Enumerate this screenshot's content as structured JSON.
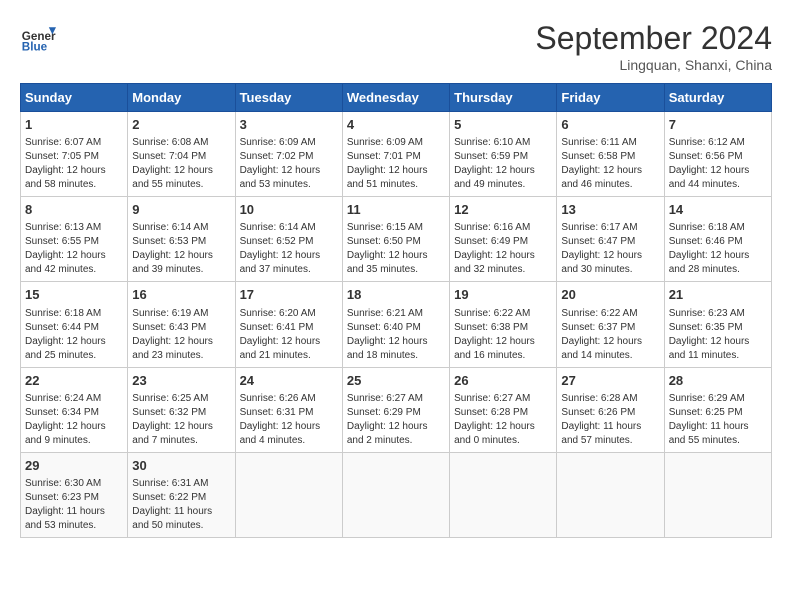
{
  "logo": {
    "line1": "General",
    "line2": "Blue"
  },
  "title": "September 2024",
  "subtitle": "Lingquan, Shanxi, China",
  "days_header": [
    "Sunday",
    "Monday",
    "Tuesday",
    "Wednesday",
    "Thursday",
    "Friday",
    "Saturday"
  ],
  "weeks": [
    [
      {
        "day": "1",
        "lines": [
          "Sunrise: 6:07 AM",
          "Sunset: 7:05 PM",
          "Daylight: 12 hours",
          "and 58 minutes."
        ]
      },
      {
        "day": "2",
        "lines": [
          "Sunrise: 6:08 AM",
          "Sunset: 7:04 PM",
          "Daylight: 12 hours",
          "and 55 minutes."
        ]
      },
      {
        "day": "3",
        "lines": [
          "Sunrise: 6:09 AM",
          "Sunset: 7:02 PM",
          "Daylight: 12 hours",
          "and 53 minutes."
        ]
      },
      {
        "day": "4",
        "lines": [
          "Sunrise: 6:09 AM",
          "Sunset: 7:01 PM",
          "Daylight: 12 hours",
          "and 51 minutes."
        ]
      },
      {
        "day": "5",
        "lines": [
          "Sunrise: 6:10 AM",
          "Sunset: 6:59 PM",
          "Daylight: 12 hours",
          "and 49 minutes."
        ]
      },
      {
        "day": "6",
        "lines": [
          "Sunrise: 6:11 AM",
          "Sunset: 6:58 PM",
          "Daylight: 12 hours",
          "and 46 minutes."
        ]
      },
      {
        "day": "7",
        "lines": [
          "Sunrise: 6:12 AM",
          "Sunset: 6:56 PM",
          "Daylight: 12 hours",
          "and 44 minutes."
        ]
      }
    ],
    [
      {
        "day": "8",
        "lines": [
          "Sunrise: 6:13 AM",
          "Sunset: 6:55 PM",
          "Daylight: 12 hours",
          "and 42 minutes."
        ]
      },
      {
        "day": "9",
        "lines": [
          "Sunrise: 6:14 AM",
          "Sunset: 6:53 PM",
          "Daylight: 12 hours",
          "and 39 minutes."
        ]
      },
      {
        "day": "10",
        "lines": [
          "Sunrise: 6:14 AM",
          "Sunset: 6:52 PM",
          "Daylight: 12 hours",
          "and 37 minutes."
        ]
      },
      {
        "day": "11",
        "lines": [
          "Sunrise: 6:15 AM",
          "Sunset: 6:50 PM",
          "Daylight: 12 hours",
          "and 35 minutes."
        ]
      },
      {
        "day": "12",
        "lines": [
          "Sunrise: 6:16 AM",
          "Sunset: 6:49 PM",
          "Daylight: 12 hours",
          "and 32 minutes."
        ]
      },
      {
        "day": "13",
        "lines": [
          "Sunrise: 6:17 AM",
          "Sunset: 6:47 PM",
          "Daylight: 12 hours",
          "and 30 minutes."
        ]
      },
      {
        "day": "14",
        "lines": [
          "Sunrise: 6:18 AM",
          "Sunset: 6:46 PM",
          "Daylight: 12 hours",
          "and 28 minutes."
        ]
      }
    ],
    [
      {
        "day": "15",
        "lines": [
          "Sunrise: 6:18 AM",
          "Sunset: 6:44 PM",
          "Daylight: 12 hours",
          "and 25 minutes."
        ]
      },
      {
        "day": "16",
        "lines": [
          "Sunrise: 6:19 AM",
          "Sunset: 6:43 PM",
          "Daylight: 12 hours",
          "and 23 minutes."
        ]
      },
      {
        "day": "17",
        "lines": [
          "Sunrise: 6:20 AM",
          "Sunset: 6:41 PM",
          "Daylight: 12 hours",
          "and 21 minutes."
        ]
      },
      {
        "day": "18",
        "lines": [
          "Sunrise: 6:21 AM",
          "Sunset: 6:40 PM",
          "Daylight: 12 hours",
          "and 18 minutes."
        ]
      },
      {
        "day": "19",
        "lines": [
          "Sunrise: 6:22 AM",
          "Sunset: 6:38 PM",
          "Daylight: 12 hours",
          "and 16 minutes."
        ]
      },
      {
        "day": "20",
        "lines": [
          "Sunrise: 6:22 AM",
          "Sunset: 6:37 PM",
          "Daylight: 12 hours",
          "and 14 minutes."
        ]
      },
      {
        "day": "21",
        "lines": [
          "Sunrise: 6:23 AM",
          "Sunset: 6:35 PM",
          "Daylight: 12 hours",
          "and 11 minutes."
        ]
      }
    ],
    [
      {
        "day": "22",
        "lines": [
          "Sunrise: 6:24 AM",
          "Sunset: 6:34 PM",
          "Daylight: 12 hours",
          "and 9 minutes."
        ]
      },
      {
        "day": "23",
        "lines": [
          "Sunrise: 6:25 AM",
          "Sunset: 6:32 PM",
          "Daylight: 12 hours",
          "and 7 minutes."
        ]
      },
      {
        "day": "24",
        "lines": [
          "Sunrise: 6:26 AM",
          "Sunset: 6:31 PM",
          "Daylight: 12 hours",
          "and 4 minutes."
        ]
      },
      {
        "day": "25",
        "lines": [
          "Sunrise: 6:27 AM",
          "Sunset: 6:29 PM",
          "Daylight: 12 hours",
          "and 2 minutes."
        ]
      },
      {
        "day": "26",
        "lines": [
          "Sunrise: 6:27 AM",
          "Sunset: 6:28 PM",
          "Daylight: 12 hours",
          "and 0 minutes."
        ]
      },
      {
        "day": "27",
        "lines": [
          "Sunrise: 6:28 AM",
          "Sunset: 6:26 PM",
          "Daylight: 11 hours",
          "and 57 minutes."
        ]
      },
      {
        "day": "28",
        "lines": [
          "Sunrise: 6:29 AM",
          "Sunset: 6:25 PM",
          "Daylight: 11 hours",
          "and 55 minutes."
        ]
      }
    ],
    [
      {
        "day": "29",
        "lines": [
          "Sunrise: 6:30 AM",
          "Sunset: 6:23 PM",
          "Daylight: 11 hours",
          "and 53 minutes."
        ]
      },
      {
        "day": "30",
        "lines": [
          "Sunrise: 6:31 AM",
          "Sunset: 6:22 PM",
          "Daylight: 11 hours",
          "and 50 minutes."
        ]
      },
      {
        "day": "",
        "lines": []
      },
      {
        "day": "",
        "lines": []
      },
      {
        "day": "",
        "lines": []
      },
      {
        "day": "",
        "lines": []
      },
      {
        "day": "",
        "lines": []
      }
    ]
  ]
}
